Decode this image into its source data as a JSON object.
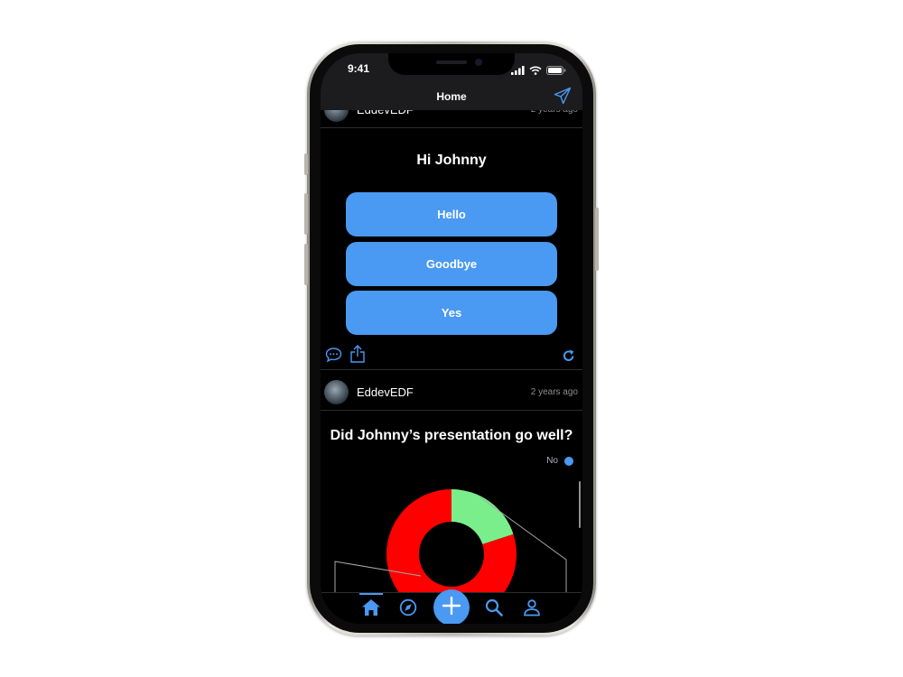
{
  "status_bar": {
    "time": "9:41"
  },
  "header": {
    "title": "Home"
  },
  "posts": [
    {
      "username": "EddevEDF",
      "time_ago": "2 years ago",
      "question": "Hi Johnny",
      "options": [
        "Hello",
        "Goodbye",
        "Yes"
      ]
    },
    {
      "username": "EddevEDF",
      "time_ago": "2 years ago",
      "question": "Did Johnny’s presentation go well?",
      "legend": [
        {
          "label": "No",
          "color": "#4a99f2"
        }
      ]
    }
  ],
  "chart_data": {
    "type": "pie",
    "variant": "donut",
    "series": [
      {
        "value": 80,
        "color": "#ff0000"
      },
      {
        "value": 20,
        "color": "#7aee8a"
      }
    ]
  },
  "icons": {
    "send": "paper-plane-icon",
    "comment": "comment-icon",
    "share": "share-icon",
    "refresh": "refresh-icon",
    "tabs": [
      "home-icon",
      "compass-icon",
      "plus-icon",
      "search-icon",
      "profile-icon"
    ]
  },
  "colors": {
    "accent": "#4a99f2",
    "background": "#000000",
    "header_bg": "#1c1c1e",
    "chart_red": "#ff0000",
    "chart_green": "#7aee8a"
  }
}
